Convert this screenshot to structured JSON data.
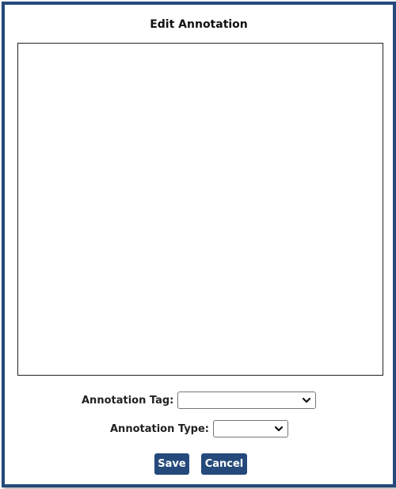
{
  "dialog": {
    "title": "Edit Annotation",
    "annotation_text": {
      "value": "",
      "placeholder": ""
    },
    "tag": {
      "label": "Annotation Tag:",
      "selected": "",
      "icon": "chevron-down-icon"
    },
    "type": {
      "label": "Annotation Type:",
      "selected": "",
      "icon": "chevron-down-icon"
    },
    "buttons": {
      "save": "Save",
      "cancel": "Cancel"
    }
  },
  "colors": {
    "accent": "#25497b",
    "border": "#222222",
    "background": "#ffffff"
  }
}
